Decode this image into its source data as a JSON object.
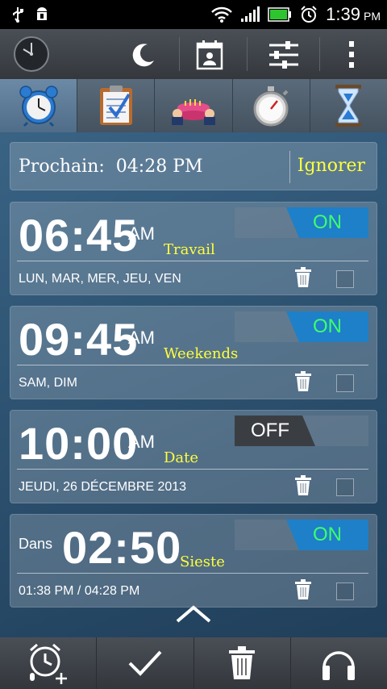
{
  "status_bar": {
    "time": "1:39",
    "ampm": "PM"
  },
  "tabs": [
    "alarm-clock-icon",
    "checklist-icon",
    "birthday-icon",
    "stopwatch-icon",
    "hourglass-icon"
  ],
  "next_alarm": {
    "label": "Prochain:",
    "time": "04:28 PM",
    "ignore_label": "Ignorer"
  },
  "alarms": [
    {
      "time": "06:45",
      "ampm": "AM",
      "name": "Travail",
      "days": "LUN, MAR, MER, JEU, VEN",
      "state": "ON"
    },
    {
      "time": "09:45",
      "ampm": "AM",
      "name": "Weekends",
      "days": "SAM, DIM",
      "state": "ON"
    },
    {
      "time": "10:00",
      "ampm": "AM",
      "name": "Date",
      "days": "JEUDI, 26 DÉCEMBRE 2013",
      "state": "OFF"
    }
  ],
  "nap": {
    "prefix": "Dans",
    "time": "02:50",
    "name": "Sieste",
    "range": "01:38 PM / 04:28 PM",
    "state": "ON"
  },
  "colors": {
    "accent_yellow": "#ffff3c",
    "on_green": "#3eff6e",
    "on_blue": "#1e80c8",
    "off_dark": "#3a3e43"
  }
}
